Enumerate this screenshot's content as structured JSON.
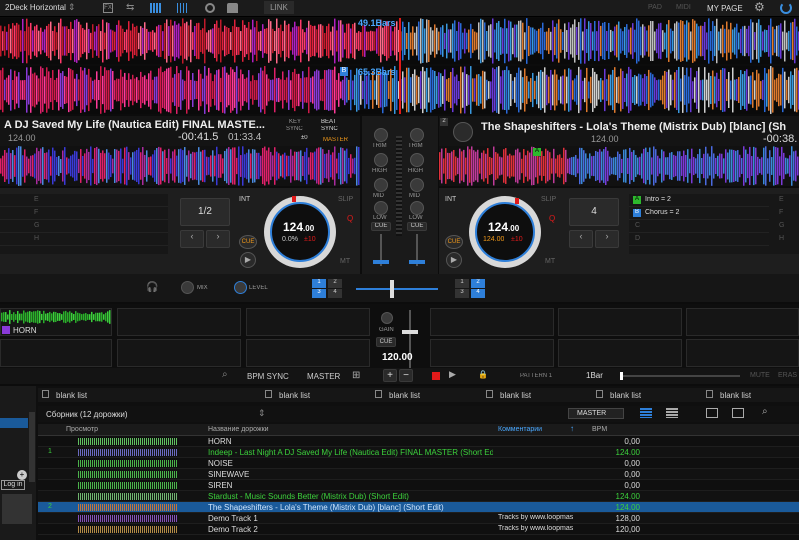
{
  "topbar": {
    "layout": "2Deck Horizontal",
    "link": "LINK",
    "pad": "PAD",
    "midi": "MIDI",
    "mypage": "MY PAGE",
    "icons": [
      "fx-icon",
      "split-icon",
      "grid-icon",
      "mixer-icon",
      "record-icon",
      "sampler-icon",
      "gear-icon",
      "logo-icon"
    ]
  },
  "waves": {
    "top_label": "49.1Bars",
    "bottom_label": "65.3Bars",
    "top_marker": "B",
    "bottom_marker": "B"
  },
  "deck1": {
    "title": "A DJ Saved My Life (Nautica Edit) FINAL MASTE...",
    "bpm_small": "124.00",
    "time_elapsed": "-00:41.5",
    "time_total": "01:33.4",
    "key_sync": "KEY",
    "key_sync2": "SYNC",
    "key_val": "±0",
    "beat_sync": "BEAT",
    "beat_sync2": "SYNC",
    "master": "MASTER",
    "loop": "1/2",
    "int": "INT",
    "slip": "SLIP",
    "cue": "CUE",
    "q": "Q",
    "mt": "MT",
    "bpm": "124",
    "bpm_dec": ".00",
    "pct": "0.0%",
    "range": "±10",
    "rows": [
      "E",
      "F",
      "G",
      "H"
    ]
  },
  "deck2": {
    "num": "2",
    "title": "The Shapeshifters - Lola's Theme (Mistrix Dub) [blanc] (Sh",
    "bpm_small": "124.00",
    "time_elapsed": "-00:38.",
    "loop": "4",
    "int": "INT",
    "slip": "SLIP",
    "cue": "CUE",
    "q": "Q",
    "mt": "MT",
    "bpm": "124",
    "bpm_dec": ".00",
    "pct": "124.00",
    "range": "±10",
    "marker": "A",
    "hotcues": [
      {
        "letter": "A",
        "label": "Intro = 2",
        "color": "#2db82d"
      },
      {
        "letter": "B",
        "label": "Chorus = 2",
        "color": "#2e7fd9"
      },
      {
        "letter": "C",
        "label": ""
      },
      {
        "letter": "D",
        "label": ""
      }
    ],
    "rows": [
      "E",
      "F",
      "G",
      "H"
    ]
  },
  "mixer": {
    "trim": "TRIM",
    "high": "HIGH",
    "mid": "MID",
    "low": "LOW",
    "cue": "CUE",
    "gain": "GAIN",
    "bpm": "120.00",
    "mix": "MIX",
    "level": "LEVEL",
    "fx_left": [
      "1",
      "2",
      "3",
      "4"
    ],
    "fx_right": [
      "1",
      "2",
      "3",
      "4"
    ]
  },
  "sampler": {
    "horn": "HORN",
    "bpm_sync": "BPM SYNC",
    "master": "MASTER",
    "pattern": "PATTERN 1",
    "bar": "1Bar",
    "mute": "MUTE",
    "erase": "ERAS"
  },
  "browser": {
    "tabs": [
      "blank list",
      "blank list",
      "blank list",
      "blank list",
      "blank list",
      "blank list"
    ],
    "collection": "Сборник (12 дорожки)",
    "master_sel": "MASTER",
    "login": "Log in",
    "headers": {
      "preview": "Просмотр",
      "title": "Название дорожки",
      "comment": "Комментарии",
      "bpm": "BPM"
    },
    "rows": [
      {
        "num": "",
        "title": "HORN",
        "comment": "",
        "bpm": "0,00",
        "style": "white"
      },
      {
        "num": "1",
        "title": "Indeep - Last Night A DJ Saved My Life (Nautica Edit) FINAL MASTER (Short Edit)",
        "comment": "",
        "bpm": "124.00",
        "style": "green"
      },
      {
        "num": "",
        "title": "NOISE",
        "comment": "",
        "bpm": "0,00",
        "style": "white"
      },
      {
        "num": "",
        "title": "SINEWAVE",
        "comment": "",
        "bpm": "0,00",
        "style": "white"
      },
      {
        "num": "",
        "title": "SIREN",
        "comment": "",
        "bpm": "0,00",
        "style": "white"
      },
      {
        "num": "",
        "title": "Stardust - Music Sounds Better (Mistrix Dub) (Short Edit)",
        "comment": "",
        "bpm": "124.00",
        "style": "green"
      },
      {
        "num": "2",
        "title": "The Shapeshifters - Lola's Theme (Mistrix Dub) [blanc] (Short Edit)",
        "comment": "",
        "bpm": "124.00",
        "style": "sel"
      },
      {
        "num": "",
        "title": "Demo Track 1",
        "comment": "Tracks by www.loopmas",
        "bpm": "128,00",
        "style": "white"
      },
      {
        "num": "",
        "title": "Demo Track 2",
        "comment": "Tracks by www.loopmas",
        "bpm": "120,00",
        "style": "white"
      }
    ]
  },
  "colors": {
    "accent": "#2e7fd9",
    "green": "#3cd13c",
    "red": "#e01a1a"
  }
}
